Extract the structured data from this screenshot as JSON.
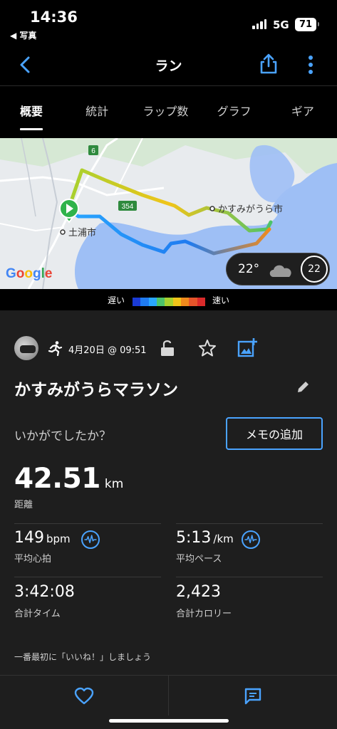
{
  "status_bar": {
    "time": "14:36",
    "back_app": "◀ 写真",
    "network": "5G",
    "battery": "71"
  },
  "nav": {
    "title": "ラン",
    "back_icon": "chevron-left-icon",
    "share_icon": "share-icon",
    "more_icon": "more-vertical-icon"
  },
  "tabs": [
    {
      "label": "概要",
      "active": true
    },
    {
      "label": "統計",
      "active": false
    },
    {
      "label": "ラップ数",
      "active": false
    },
    {
      "label": "グラフ",
      "active": false
    },
    {
      "label": "ギア",
      "active": false
    }
  ],
  "map": {
    "label_start": "土浦市",
    "label_end": "かすみがうら市",
    "route_number_a": "6",
    "route_number_b": "354",
    "provider": "Google",
    "weather": {
      "temp": "22°",
      "wind": "22"
    }
  },
  "legend": {
    "slow": "遅い",
    "fast": "速い",
    "colors": [
      "#1a3bd6",
      "#1f7bf0",
      "#29a7ff",
      "#4cc36a",
      "#a6d12f",
      "#f0c419",
      "#f08a1c",
      "#e5542a",
      "#d92a2a"
    ]
  },
  "activity": {
    "date": "4月20日 @ 09:51",
    "title": "かすみがうらマラソン",
    "question": "いかがでしたか？",
    "memo_button": "メモの追加"
  },
  "stats": {
    "distance": {
      "value": "42.51",
      "unit": "km",
      "label": "距離"
    },
    "heart_rate": {
      "value": "149",
      "unit": "bpm",
      "label": "平均心拍"
    },
    "pace": {
      "value": "5:13",
      "unit": "/km",
      "label": "平均ペース"
    },
    "time": {
      "value": "3:42:08",
      "label": "合計タイム"
    },
    "calories": {
      "value": "2,423",
      "label": "合計カロリー"
    }
  },
  "social": {
    "prompt": "一番最初に「いいね！」しましょう",
    "like_icon": "heart-icon",
    "comment_icon": "comment-icon"
  },
  "colors": {
    "accent": "#4aa3ff",
    "background": "#1e1e1e",
    "start_marker": "#2fb34a"
  }
}
